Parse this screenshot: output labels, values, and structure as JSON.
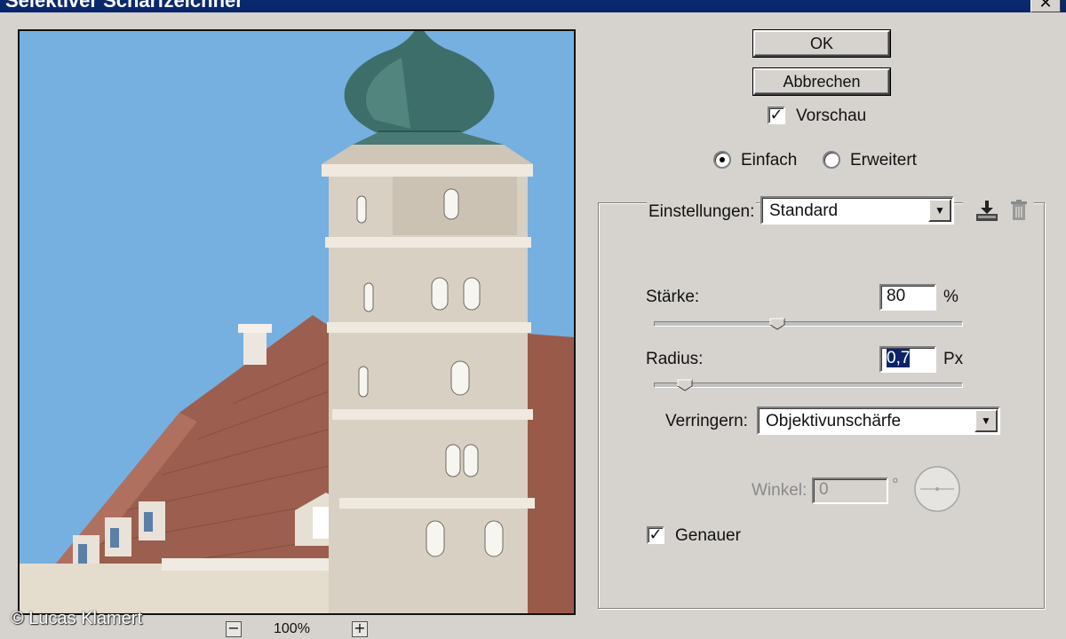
{
  "window": {
    "title": "Selektiver Scharfzeichner",
    "close_glyph": "✕"
  },
  "buttons": {
    "ok": "OK",
    "cancel": "Abbrechen"
  },
  "preview_toggle": {
    "label": "Vorschau",
    "checked": true,
    "glyph": "✓"
  },
  "mode": {
    "simple": {
      "label": "Einfach",
      "selected": true
    },
    "advanced": {
      "label": "Erweitert",
      "selected": false
    }
  },
  "settings": {
    "label": "Einstellungen:",
    "value": "Standard",
    "arrow_glyph": "▼",
    "icons": [
      "save-settings-icon",
      "delete-settings-icon"
    ]
  },
  "amount": {
    "label": "Stärke:",
    "value": "80",
    "unit": "%",
    "slider_fraction": 0.4
  },
  "radius": {
    "label": "Radius:",
    "value": "0,7",
    "unit": "Px",
    "slider_fraction": 0.1
  },
  "remove": {
    "label": "Verringern:",
    "value": "Objektivunschärfe",
    "arrow_glyph": "▼"
  },
  "angle": {
    "label": "Winkel:",
    "value": "0",
    "unit": "°"
  },
  "more_accurate": {
    "label": "Genauer",
    "checked": true,
    "glyph": "✓"
  },
  "zoom": {
    "minus_glyph": "−",
    "plus_glyph": "+",
    "level": "100%"
  },
  "watermark": "© Lucas Klamert",
  "colors": {
    "dialog_bg": "#d6d3ce",
    "titlebar": "#0a246a",
    "sky": "#76b0e0",
    "selection": "#0a246a"
  }
}
